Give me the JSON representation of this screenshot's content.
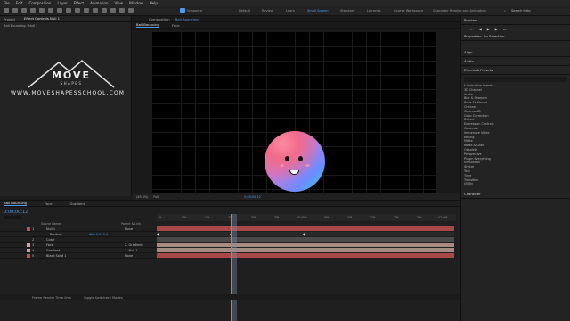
{
  "menu": [
    "File",
    "Edit",
    "Composition",
    "Layer",
    "Effect",
    "Animation",
    "View",
    "Window",
    "Help"
  ],
  "toolbar": {
    "snapping_label": "Snapping",
    "workspaces": [
      "Default",
      "Review",
      "Learn",
      "Small Screen",
      "Standard",
      "Libraries",
      "Course Workspace",
      "Character Rigging and Animation"
    ],
    "active_workspace_index": 3,
    "search_placeholder": "Search Help"
  },
  "left_panel": {
    "tabs": [
      "Project",
      "Effect Controls Null 1"
    ],
    "breadcrumb": "Ball Bouncing · Null 1",
    "logo_text": "MOVE",
    "logo_sub": "SHAPES",
    "website": "WWW.MOVESHAPESSCHOOL.COM"
  },
  "composition": {
    "panel_label": "Composition",
    "comp_name": "Ball Bouncing",
    "tabs": [
      "Ball Bouncing",
      "Face"
    ],
    "zoom": "(49.6%)",
    "quality": "Full",
    "timecode": "0;00;00;12"
  },
  "right_panel": {
    "preview_label": "Preview",
    "properties_label": "Properties: No Selection",
    "align_label": "Align",
    "audio_label": "Audio",
    "effects_label": "Effects & Presets",
    "effects": [
      "* Animation Presets",
      "3D Channel",
      "Audio",
      "Blur & Sharpen",
      "Boris FX Mocha",
      "Channel",
      "Cinema 4D",
      "Color Correction",
      "Distort",
      "Expression Controls",
      "Generate",
      "Immersive Video",
      "Keying",
      "Matte",
      "Noise & Grain",
      "Obsolete",
      "Perspective",
      "Plugin Everything",
      "Simulation",
      "Stylize",
      "Text",
      "Time",
      "Transition",
      "Utility"
    ],
    "character_label": "Character"
  },
  "timeline": {
    "tabs": [
      "Ball Bouncing",
      "Face",
      "Gradient"
    ],
    "timecode": "0;00;00;12",
    "col_source": "Source Name",
    "col_parent": "Parent & Link",
    "layers": [
      {
        "num": "1",
        "name": "Null 1",
        "parent": "None",
        "color": "#c85050"
      },
      {
        "num": "",
        "name": "Position",
        "parent": "",
        "color": "#000000",
        "value": "960.0,540.0"
      },
      {
        "num": "2",
        "name": "Color",
        "parent": "",
        "color": "#4a9cf0"
      },
      {
        "num": "3",
        "name": "Face",
        "parent": "2. Gradient",
        "color": "#d9a0a0"
      },
      {
        "num": "4",
        "name": "Gradient",
        "parent": "1. Null 1",
        "color": "#d9a0a0"
      },
      {
        "num": "5",
        "name": "Black Solid 1",
        "parent": "None",
        "color": "#c85050"
      }
    ],
    "ruler": [
      "0f",
      "05f",
      "10f",
      "15f",
      "20f",
      "25f",
      "01:00f",
      "05f",
      "10f",
      "15f",
      "20f",
      "25f",
      "02:00f"
    ],
    "status": [
      "Frame Render Time  0ms",
      "Toggle Switches / Modes"
    ],
    "playhead_fraction": 0.245
  }
}
